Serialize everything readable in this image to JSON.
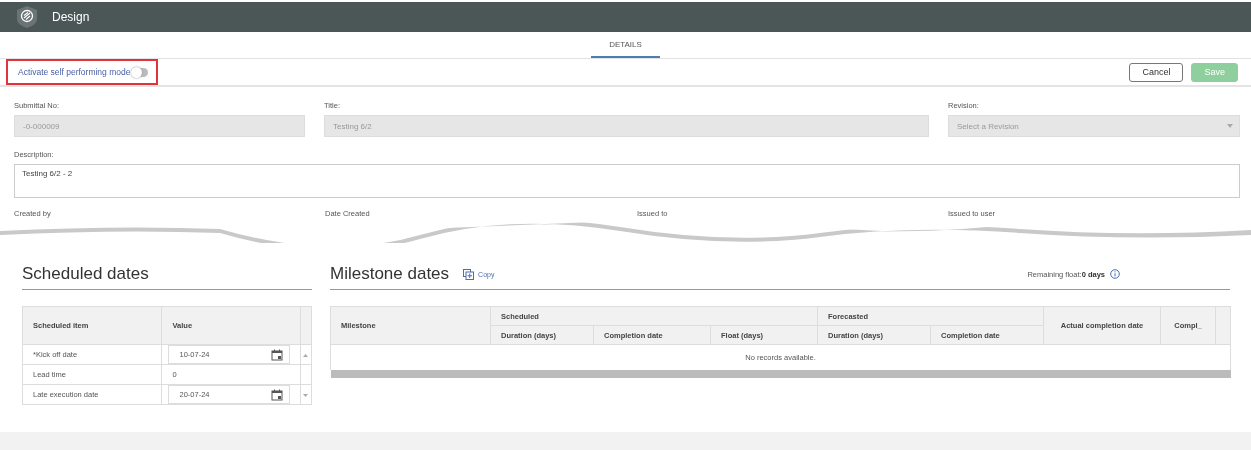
{
  "header": {
    "title": "Design"
  },
  "tabs": [
    {
      "label": "DETAILS",
      "selected": true
    }
  ],
  "self_performing": {
    "label": "Activate self performing mode",
    "on": false
  },
  "actions": [
    {
      "label": "Cancel",
      "kind": "outline"
    },
    {
      "label": "Save",
      "kind": "primary",
      "disabled": true
    }
  ],
  "fields": [
    {
      "label": "Submittal No:",
      "value": "-0-000009",
      "kind": "text"
    },
    {
      "label": "Title:",
      "value": "Testing 6/2",
      "kind": "text"
    },
    {
      "label": "Revision:",
      "placeholder": "Select a Revision",
      "kind": "select"
    }
  ],
  "description": {
    "label": "Description:",
    "value": "Testing 6/2 - 2"
  },
  "cut_labels": [
    "Created by",
    "Date Created",
    "Issued to",
    "Issued to user"
  ],
  "scheduled": {
    "title": "Scheduled dates",
    "columns": [
      "Scheduled item",
      "Value"
    ],
    "rows": [
      {
        "item": "*Kick off date",
        "value": "10-07-24",
        "kind": "date"
      },
      {
        "item": "Lead time",
        "value": "0",
        "kind": "number"
      },
      {
        "item": "Late execution date",
        "value": "20-07-24",
        "kind": "date"
      }
    ]
  },
  "milestones": {
    "title": "Milestone dates",
    "copy_label": "Copy",
    "remaining_label": "Remaining float:",
    "remaining_value": "0 days",
    "first_column": "Milestone",
    "groups": [
      {
        "label": "Scheduled",
        "columns": [
          "Duration (days)",
          "Completion date",
          "Float (days)"
        ]
      },
      {
        "label": "Forecasted",
        "columns": [
          "Duration (days)",
          "Completion date"
        ]
      }
    ],
    "last_columns": [
      "Actual completion date",
      "Compl_"
    ],
    "empty": "No records available."
  }
}
